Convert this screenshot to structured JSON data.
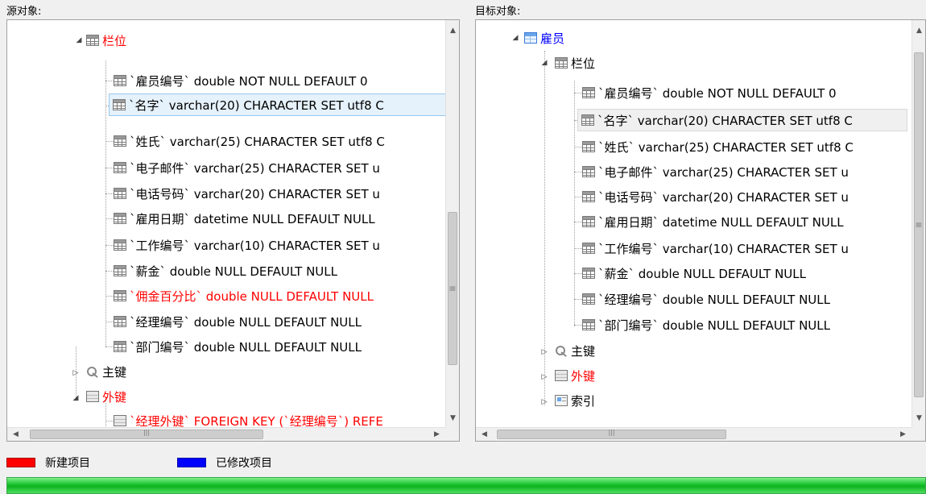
{
  "source": {
    "label": "源对象:",
    "rows": [
      {
        "text": "栏位",
        "color": "red",
        "icon": "column-grid-icon"
      },
      {
        "text": "`雇员编号` double NOT NULL DEFAULT 0",
        "color": "black",
        "icon": "column-grid-icon"
      },
      {
        "text": "`名字` varchar(20) CHARACTER SET utf8 C",
        "color": "black",
        "icon": "column-grid-icon"
      },
      {
        "text": "`姓氏` varchar(25) CHARACTER SET utf8 C",
        "color": "black",
        "icon": "column-grid-icon"
      },
      {
        "text": "`电子邮件` varchar(25) CHARACTER SET u",
        "color": "black",
        "icon": "column-grid-icon"
      },
      {
        "text": "`电话号码` varchar(20) CHARACTER SET u",
        "color": "black",
        "icon": "column-grid-icon"
      },
      {
        "text": "`雇用日期` datetime NULL DEFAULT NULL",
        "color": "black",
        "icon": "column-grid-icon"
      },
      {
        "text": "`工作编号` varchar(10) CHARACTER SET u",
        "color": "black",
        "icon": "column-grid-icon"
      },
      {
        "text": "`薪金` double NULL DEFAULT NULL",
        "color": "black",
        "icon": "column-grid-icon"
      },
      {
        "text": "`佣金百分比` double NULL DEFAULT NULL",
        "color": "red",
        "icon": "column-grid-icon"
      },
      {
        "text": "`经理编号` double NULL DEFAULT NULL",
        "color": "black",
        "icon": "column-grid-icon"
      },
      {
        "text": "`部门编号` double NULL DEFAULT NULL",
        "color": "black",
        "icon": "column-grid-icon"
      },
      {
        "text": "主键",
        "color": "black",
        "icon": "key-icon"
      },
      {
        "text": "外键",
        "color": "red",
        "icon": "foreign-key-icon"
      },
      {
        "text": "`经理外键` FOREIGN KEY (`经理编号`) REFE",
        "color": "red",
        "icon": "foreign-key-icon"
      }
    ]
  },
  "target": {
    "label": "目标对象:",
    "rows": [
      {
        "text": "雇员",
        "color": "blue",
        "icon": "table-icon"
      },
      {
        "text": "栏位",
        "color": "black",
        "icon": "column-grid-icon"
      },
      {
        "text": "`雇员编号` double NOT NULL DEFAULT 0",
        "color": "black",
        "icon": "column-grid-icon"
      },
      {
        "text": "`名字` varchar(20) CHARACTER SET utf8 C",
        "color": "black",
        "icon": "column-grid-icon"
      },
      {
        "text": "`姓氏` varchar(25) CHARACTER SET utf8 C",
        "color": "black",
        "icon": "column-grid-icon"
      },
      {
        "text": "`电子邮件` varchar(25) CHARACTER SET u",
        "color": "black",
        "icon": "column-grid-icon"
      },
      {
        "text": "`电话号码` varchar(20) CHARACTER SET u",
        "color": "black",
        "icon": "column-grid-icon"
      },
      {
        "text": "`雇用日期` datetime NULL DEFAULT NULL",
        "color": "black",
        "icon": "column-grid-icon"
      },
      {
        "text": "`工作编号` varchar(10) CHARACTER SET u",
        "color": "black",
        "icon": "column-grid-icon"
      },
      {
        "text": "`薪金` double NULL DEFAULT NULL",
        "color": "black",
        "icon": "column-grid-icon"
      },
      {
        "text": "`经理编号` double NULL DEFAULT NULL",
        "color": "black",
        "icon": "column-grid-icon"
      },
      {
        "text": "`部门编号` double NULL DEFAULT NULL",
        "color": "black",
        "icon": "column-grid-icon"
      },
      {
        "text": "主键",
        "color": "black",
        "icon": "key-icon"
      },
      {
        "text": "外键",
        "color": "red",
        "icon": "foreign-key-icon"
      },
      {
        "text": "索引",
        "color": "black",
        "icon": "index-icon"
      }
    ]
  },
  "legend": {
    "new_label": "新建项目",
    "new_color": "#ff0000",
    "modified_label": "已修改项目",
    "modified_color": "#0000ff"
  },
  "progress": {
    "percent": 100,
    "color": "#17c12a"
  }
}
